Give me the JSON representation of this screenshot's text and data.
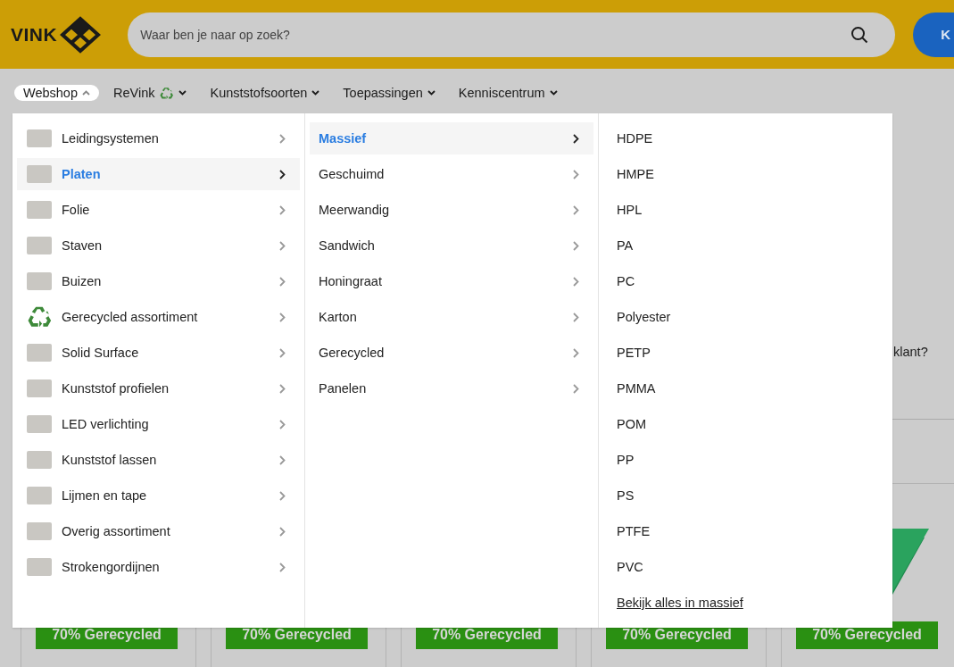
{
  "header": {
    "logo": "VINK",
    "search": {
      "placeholder": "Waar ben je naar op zoek?"
    },
    "button": "K"
  },
  "nav": [
    {
      "label": "Webshop",
      "kind": "plain",
      "expanded": true
    },
    {
      "label": "ReVink",
      "kind": "recycle",
      "expanded": false
    },
    {
      "label": "Kunststofsoorten",
      "kind": "plain",
      "expanded": false
    },
    {
      "label": "Toepassingen",
      "kind": "plain",
      "expanded": false
    },
    {
      "label": "Kenniscentrum",
      "kind": "plain",
      "expanded": false
    }
  ],
  "menu": {
    "categories": [
      {
        "label": "Leidingsystemen",
        "kind": "photo",
        "selected": false
      },
      {
        "label": "Platen",
        "kind": "photo",
        "selected": true
      },
      {
        "label": "Folie",
        "kind": "photo",
        "selected": false
      },
      {
        "label": "Staven",
        "kind": "photo",
        "selected": false
      },
      {
        "label": "Buizen",
        "kind": "photo",
        "selected": false
      },
      {
        "label": "Gerecycled assortiment",
        "kind": "recycle",
        "selected": false
      },
      {
        "label": "Solid Surface",
        "kind": "photo",
        "selected": false
      },
      {
        "label": "Kunststof profielen",
        "kind": "photo",
        "selected": false
      },
      {
        "label": "LED verlichting",
        "kind": "photo",
        "selected": false
      },
      {
        "label": "Kunststof lassen",
        "kind": "photo",
        "selected": false
      },
      {
        "label": "Lijmen en tape",
        "kind": "photo",
        "selected": false
      },
      {
        "label": "Overig assortiment",
        "kind": "photo",
        "selected": false
      },
      {
        "label": "Strokengordijnen",
        "kind": "photo",
        "selected": false
      }
    ],
    "subcategories": [
      {
        "label": "Massief",
        "selected": true
      },
      {
        "label": "Geschuimd",
        "selected": false
      },
      {
        "label": "Meerwandig",
        "selected": false
      },
      {
        "label": "Sandwich",
        "selected": false
      },
      {
        "label": "Honingraat",
        "selected": false
      },
      {
        "label": "Karton",
        "selected": false
      },
      {
        "label": "Gerecycled",
        "selected": false
      },
      {
        "label": "Panelen",
        "selected": false
      }
    ],
    "materials": [
      "HDPE",
      "HMPE",
      "HPL",
      "PA",
      "PC",
      "Polyester",
      "PETP",
      "PMMA",
      "POM",
      "PP",
      "PS",
      "PTFE",
      "PVC"
    ],
    "view_all": "Bekijk alles in massief"
  },
  "background": {
    "text": "klant?",
    "cards": [
      {
        "badge": "70% Gerecycled"
      },
      {
        "badge": "70% Gerecycled"
      },
      {
        "badge": "70% Gerecycled"
      },
      {
        "badge": "70% Gerecycled"
      },
      {
        "badge": "70% Gerecycled"
      }
    ]
  }
}
